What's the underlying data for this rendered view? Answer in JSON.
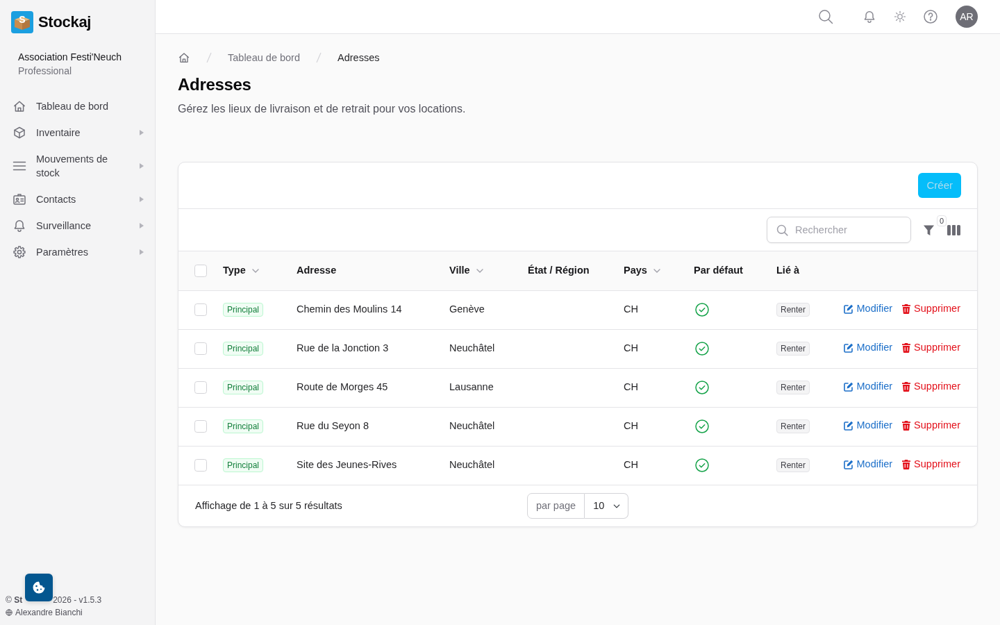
{
  "brand": {
    "mark": "S",
    "name": "Stockaj"
  },
  "organization": {
    "name": "Association Festi'Neuch",
    "plan": "Professional"
  },
  "sidebar": {
    "items": [
      {
        "label": "Tableau de bord",
        "kind": "link"
      },
      {
        "label": "Inventaire",
        "kind": "group"
      },
      {
        "label": "Mouvements de stock",
        "kind": "group"
      },
      {
        "label": "Contacts",
        "kind": "group"
      },
      {
        "label": "Surveillance",
        "kind": "group"
      },
      {
        "label": "Paramètres",
        "kind": "group"
      }
    ],
    "footer": {
      "copyright": "© **St**",
      "version": "2026 - v1.5.3",
      "author": "Alexandre Bianchi"
    }
  },
  "topbar": {
    "avatar": "AR"
  },
  "breadcrumb": [
    {
      "label": "Tableau de bord",
      "current": false
    },
    {
      "label": "Adresses",
      "current": true
    }
  ],
  "page": {
    "title": "Adresses",
    "description": "Gérez les lieux de livraison et de retrait pour vos locations."
  },
  "card": {
    "create_button": {
      "label": "Créer",
      "disabled": true
    },
    "search": {
      "placeholder": "Rechercher"
    },
    "filter_count": "0"
  },
  "table": {
    "all_checked": false,
    "columns": [
      {
        "label": "Type",
        "sortable": true
      },
      {
        "label": "Adresse",
        "sortable": false
      },
      {
        "label": "Ville",
        "sortable": true
      },
      {
        "label": "État / Région",
        "sortable": false
      },
      {
        "label": "Pays",
        "sortable": true
      },
      {
        "label": "Par défaut",
        "sortable": false
      },
      {
        "label": "Lié à",
        "sortable": false
      }
    ],
    "rows": [
      {
        "selected": false,
        "type": "Principal",
        "address": "Chemin des Moulins 14",
        "city": "Genève",
        "country": "CH",
        "default": true,
        "linked_to": "Renter",
        "actions": [
          {
            "kind": "edit",
            "label": "Modifier"
          },
          {
            "kind": "delete",
            "label": "Supprimer"
          }
        ]
      },
      {
        "selected": false,
        "type": "Principal",
        "address": "Rue de la Jonction 3",
        "city": "Neuchâtel",
        "country": "CH",
        "default": true,
        "linked_to": "Renter",
        "actions": [
          {
            "kind": "edit",
            "label": "Modifier"
          },
          {
            "kind": "delete",
            "label": "Supprimer"
          }
        ]
      },
      {
        "selected": false,
        "type": "Principal",
        "address": "Route de Morges 45",
        "city": "Lausanne",
        "country": "CH",
        "default": true,
        "linked_to": "Renter",
        "actions": [
          {
            "kind": "edit",
            "label": "Modifier"
          },
          {
            "kind": "delete",
            "label": "Supprimer"
          }
        ]
      },
      {
        "selected": false,
        "type": "Principal",
        "address": "Rue du Seyon 8",
        "city": "Neuchâtel",
        "country": "CH",
        "default": true,
        "linked_to": "Renter",
        "actions": [
          {
            "kind": "edit",
            "label": "Modifier"
          },
          {
            "kind": "delete",
            "label": "Supprimer"
          }
        ]
      },
      {
        "selected": false,
        "type": "Principal",
        "address": "Site des Jeunes-Rives",
        "city": "Neuchâtel",
        "country": "CH",
        "default": true,
        "linked_to": "Renter",
        "actions": [
          {
            "kind": "edit",
            "label": "Modifier"
          },
          {
            "kind": "delete",
            "label": "Supprimer"
          }
        ]
      }
    ]
  },
  "pagination": {
    "summary": "Affichage de 1 à 5 sur 5 résultats",
    "per_page_label": "par page",
    "per_page": "10"
  }
}
